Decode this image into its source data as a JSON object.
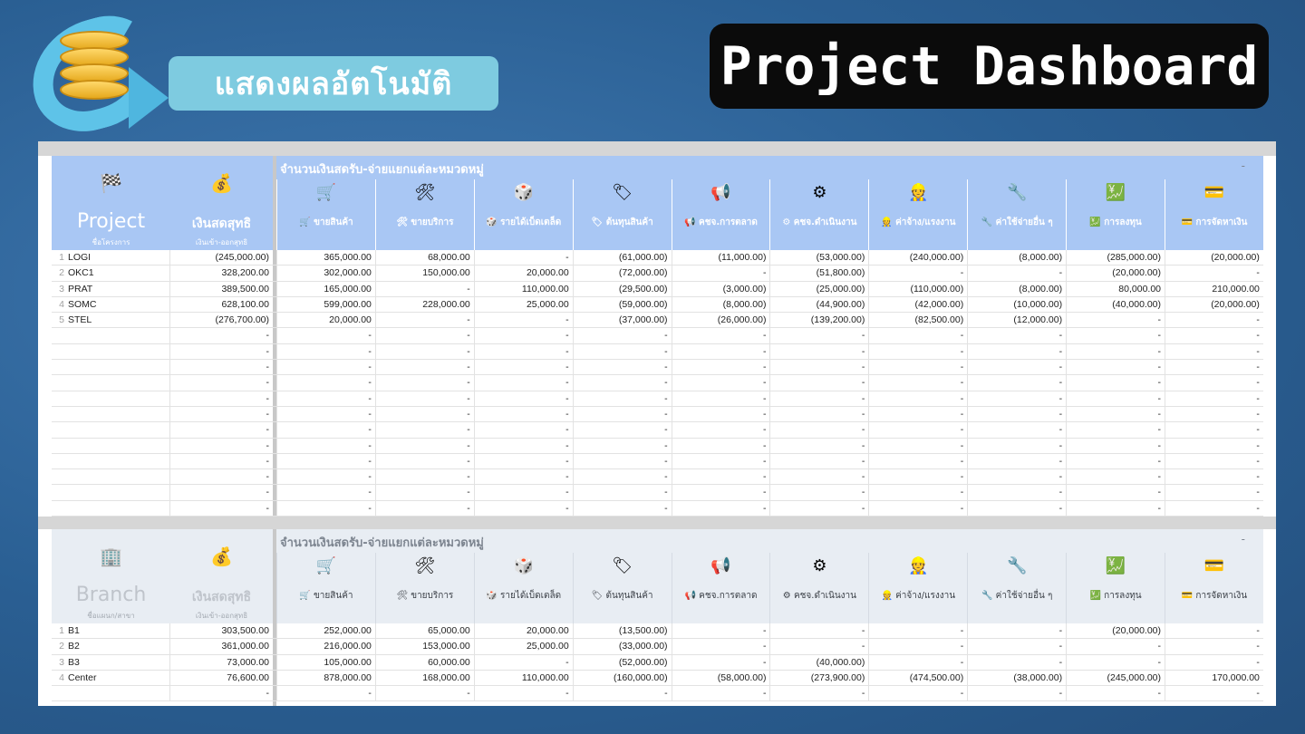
{
  "subtitle": "แสดงผลอัตโนมัติ",
  "title": "Project Dashboard",
  "categories": [
    {
      "icon": "🛒",
      "label": "🛒 ขายสินค้า"
    },
    {
      "icon": "🛠",
      "label": "🛠 ขายบริการ"
    },
    {
      "icon": "🎲",
      "label": "🎲 รายได้เบ็ดเตล็ด"
    },
    {
      "icon": "🏷",
      "label": "🏷 ต้นทุนสินค้า"
    },
    {
      "icon": "📢",
      "label": "📢 คชจ.การตลาด"
    },
    {
      "icon": "⚙",
      "label": "⚙ คชจ.ดำเนินงาน"
    },
    {
      "icon": "👷",
      "label": "👷 ค่าจ้าง/แรงงาน"
    },
    {
      "icon": "🔧",
      "label": "🔧 ค่าใช้จ่ายอื่น ๆ"
    },
    {
      "icon": "💹",
      "label": "💹 การลงทุน"
    },
    {
      "icon": "💳",
      "label": "💳 การจัดหาเงิน"
    }
  ],
  "project": {
    "icon": "🏁",
    "title": "Project",
    "title_sub": "ชื่อโครงการ",
    "cash_icon": "💰",
    "cash_title": "เงินสดสุทธิ",
    "cash_sub": "เงินเข้า-ออกสุทธิ",
    "group_title": "จำนวนเงินสดรับ-จ่ายแยกแต่ละหมวดหมู่",
    "dash": "-",
    "rows": [
      {
        "n": "1",
        "name": "LOGI",
        "cash": "(245,000.00)",
        "v": [
          "365,000.00",
          "68,000.00",
          "-",
          "(61,000.00)",
          "(11,000.00)",
          "(53,000.00)",
          "(240,000.00)",
          "(8,000.00)",
          "(285,000.00)",
          "(20,000.00)"
        ]
      },
      {
        "n": "2",
        "name": "OKC1",
        "cash": "328,200.00",
        "v": [
          "302,000.00",
          "150,000.00",
          "20,000.00",
          "(72,000.00)",
          "-",
          "(51,800.00)",
          "-",
          "-",
          "(20,000.00)",
          "-"
        ]
      },
      {
        "n": "3",
        "name": "PRAT",
        "cash": "389,500.00",
        "v": [
          "165,000.00",
          "-",
          "110,000.00",
          "(29,500.00)",
          "(3,000.00)",
          "(25,000.00)",
          "(110,000.00)",
          "(8,000.00)",
          "80,000.00",
          "210,000.00"
        ]
      },
      {
        "n": "4",
        "name": "SOMC",
        "cash": "628,100.00",
        "v": [
          "599,000.00",
          "228,000.00",
          "25,000.00",
          "(59,000.00)",
          "(8,000.00)",
          "(44,900.00)",
          "(42,000.00)",
          "(10,000.00)",
          "(40,000.00)",
          "(20,000.00)"
        ]
      },
      {
        "n": "5",
        "name": "STEL",
        "cash": "(276,700.00)",
        "v": [
          "20,000.00",
          "-",
          "-",
          "(37,000.00)",
          "(26,000.00)",
          "(139,200.00)",
          "(82,500.00)",
          "(12,000.00)",
          "-",
          "-"
        ]
      },
      {
        "n": "",
        "name": "",
        "cash": "-",
        "v": [
          "-",
          "-",
          "-",
          "-",
          "-",
          "-",
          "-",
          "-",
          "-",
          "-"
        ]
      },
      {
        "n": "",
        "name": "",
        "cash": "-",
        "v": [
          "-",
          "-",
          "-",
          "-",
          "-",
          "-",
          "-",
          "-",
          "-",
          "-"
        ]
      },
      {
        "n": "",
        "name": "",
        "cash": "-",
        "v": [
          "-",
          "-",
          "-",
          "-",
          "-",
          "-",
          "-",
          "-",
          "-",
          "-"
        ]
      },
      {
        "n": "",
        "name": "",
        "cash": "-",
        "v": [
          "-",
          "-",
          "-",
          "-",
          "-",
          "-",
          "-",
          "-",
          "-",
          "-"
        ]
      },
      {
        "n": "",
        "name": "",
        "cash": "-",
        "v": [
          "-",
          "-",
          "-",
          "-",
          "-",
          "-",
          "-",
          "-",
          "-",
          "-"
        ]
      },
      {
        "n": "",
        "name": "",
        "cash": "-",
        "v": [
          "-",
          "-",
          "-",
          "-",
          "-",
          "-",
          "-",
          "-",
          "-",
          "-"
        ]
      },
      {
        "n": "",
        "name": "",
        "cash": "-",
        "v": [
          "-",
          "-",
          "-",
          "-",
          "-",
          "-",
          "-",
          "-",
          "-",
          "-"
        ]
      },
      {
        "n": "",
        "name": "",
        "cash": "-",
        "v": [
          "-",
          "-",
          "-",
          "-",
          "-",
          "-",
          "-",
          "-",
          "-",
          "-"
        ]
      },
      {
        "n": "",
        "name": "",
        "cash": "-",
        "v": [
          "-",
          "-",
          "-",
          "-",
          "-",
          "-",
          "-",
          "-",
          "-",
          "-"
        ]
      },
      {
        "n": "",
        "name": "",
        "cash": "-",
        "v": [
          "-",
          "-",
          "-",
          "-",
          "-",
          "-",
          "-",
          "-",
          "-",
          "-"
        ]
      },
      {
        "n": "",
        "name": "",
        "cash": "-",
        "v": [
          "-",
          "-",
          "-",
          "-",
          "-",
          "-",
          "-",
          "-",
          "-",
          "-"
        ]
      },
      {
        "n": "",
        "name": "",
        "cash": "-",
        "v": [
          "-",
          "-",
          "-",
          "-",
          "-",
          "-",
          "-",
          "-",
          "-",
          "-"
        ]
      }
    ]
  },
  "branch": {
    "icon": "🏢",
    "title": "Branch",
    "title_sub": "ชื่อแผนก/สาขา",
    "cash_icon": "💰",
    "cash_title": "เงินสดสุทธิ",
    "cash_sub": "เงินเข้า-ออกสุทธิ",
    "group_title": "จำนวนเงินสดรับ-จ่ายแยกแต่ละหมวดหมู่",
    "dash": "-",
    "rows": [
      {
        "n": "1",
        "name": "B1",
        "cash": "303,500.00",
        "v": [
          "252,000.00",
          "65,000.00",
          "20,000.00",
          "(13,500.00)",
          "-",
          "-",
          "-",
          "-",
          "(20,000.00)",
          "-"
        ]
      },
      {
        "n": "2",
        "name": "B2",
        "cash": "361,000.00",
        "v": [
          "216,000.00",
          "153,000.00",
          "25,000.00",
          "(33,000.00)",
          "-",
          "-",
          "-",
          "-",
          "-",
          "-"
        ]
      },
      {
        "n": "3",
        "name": "B3",
        "cash": "73,000.00",
        "v": [
          "105,000.00",
          "60,000.00",
          "-",
          "(52,000.00)",
          "-",
          "(40,000.00)",
          "-",
          "-",
          "-",
          "-"
        ]
      },
      {
        "n": "4",
        "name": "Center",
        "cash": "76,600.00",
        "v": [
          "878,000.00",
          "168,000.00",
          "110,000.00",
          "(160,000.00)",
          "(58,000.00)",
          "(273,900.00)",
          "(474,500.00)",
          "(38,000.00)",
          "(245,000.00)",
          "170,000.00"
        ]
      },
      {
        "n": "",
        "name": "",
        "cash": "-",
        "v": [
          "-",
          "-",
          "-",
          "-",
          "-",
          "-",
          "-",
          "-",
          "-",
          "-"
        ]
      }
    ]
  }
}
